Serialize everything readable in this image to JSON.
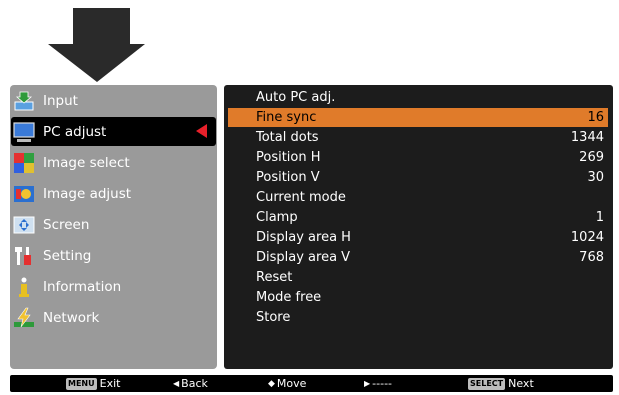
{
  "menu": [
    {
      "label": "Input",
      "icon": "input-icon"
    },
    {
      "label": "PC adjust",
      "icon": "pc-adjust-icon",
      "selected": true
    },
    {
      "label": "Image select",
      "icon": "image-select-icon"
    },
    {
      "label": "Image adjust",
      "icon": "image-adjust-icon"
    },
    {
      "label": "Screen",
      "icon": "screen-icon"
    },
    {
      "label": "Setting",
      "icon": "setting-icon"
    },
    {
      "label": "Information",
      "icon": "information-icon"
    },
    {
      "label": "Network",
      "icon": "network-icon"
    }
  ],
  "submenu": [
    {
      "label": "Auto PC adj.",
      "value": ""
    },
    {
      "label": "Fine sync",
      "value": "16",
      "highlighted": true
    },
    {
      "label": "Total dots",
      "value": "1344"
    },
    {
      "label": "Position H",
      "value": "269"
    },
    {
      "label": "Position V",
      "value": "30"
    },
    {
      "label": "Current mode",
      "value": ""
    },
    {
      "label": "Clamp",
      "value": "1"
    },
    {
      "label": "Display area H",
      "value": "1024"
    },
    {
      "label": "Display area V",
      "value": "768"
    },
    {
      "label": "Reset",
      "value": ""
    },
    {
      "label": "Mode free",
      "value": ""
    },
    {
      "label": "Store",
      "value": ""
    }
  ],
  "bottom_bar": {
    "exit": {
      "key": "MENU",
      "label": "Exit"
    },
    "back": {
      "glyph": "◀",
      "label": "Back"
    },
    "move": {
      "glyph": "◆",
      "label": "Move"
    },
    "next_dash": {
      "glyph": "▶",
      "label": "-----"
    },
    "next": {
      "key": "SELECT",
      "label": "Next"
    }
  },
  "colors": {
    "highlight": "#e07b2a",
    "selected_marker": "#e8202a",
    "left_panel": "#9a9a9a",
    "right_panel": "#1c1c1c"
  }
}
